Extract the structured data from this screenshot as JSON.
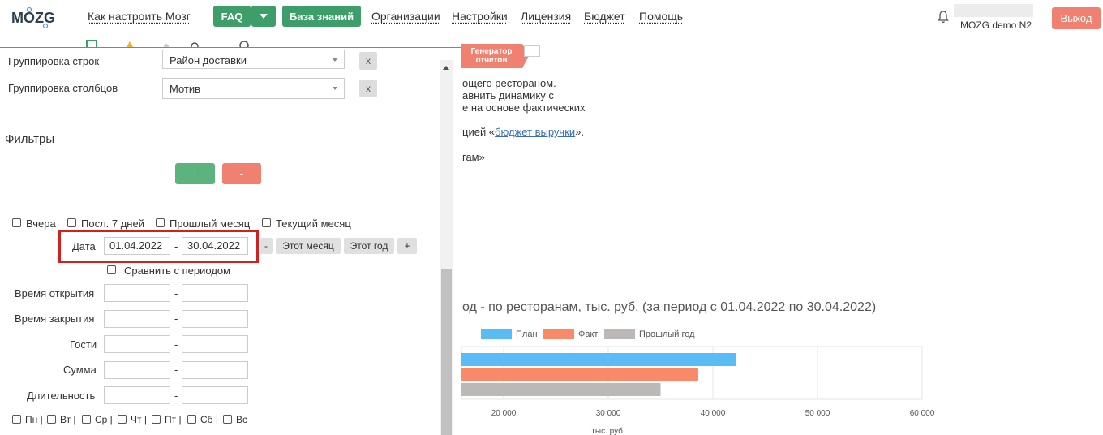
{
  "header": {
    "logo": "MOZG",
    "nav_links": [
      "Как настроить Мозг",
      "Организации",
      "Настройки",
      "Лицензия",
      "Бюджет",
      "Помощь"
    ],
    "faq_label": "FAQ",
    "kb_label": "База знаний",
    "user_name": "MOZG demo N2",
    "exit_label": "Выход"
  },
  "panel": {
    "row_grouping_label": "Группировка строк",
    "row_grouping_value": "Район доставки",
    "col_grouping_label": "Группировка столбцов",
    "col_grouping_value": "Мотив",
    "x_label": "x",
    "filters_title": "Фильтры",
    "plus_label": "+",
    "minus_label": "-",
    "quick_periods": [
      "Вчера",
      "Посл. 7 дней",
      "Прошлый месяц",
      "Текущий месяц"
    ],
    "date_label": "Дата",
    "date_from": "01.04.2022",
    "date_to": "30.04.2022",
    "date_minus": "-",
    "this_month": "Этот месяц",
    "this_year": "Этот год",
    "date_plus": "+",
    "compare_label": "Сравнить с периодом",
    "range_filters": [
      "Время открытия",
      "Время закрытия",
      "Гости",
      "Сумма",
      "Длительность"
    ],
    "range_sep": "-",
    "weekdays": [
      "Пн |",
      "Вт |",
      "Ср |",
      "Чт |",
      "Пт |",
      "Сб |",
      "Вс"
    ]
  },
  "report": {
    "tab_badge": "Генератор отчетов",
    "desc_lines": [
      "ощего рестораном.",
      "авнить динамику с",
      "е на основе фактических"
    ],
    "desc_link_prefix": "цией «",
    "desc_link": "бюджет выручки",
    "desc_link_suffix": "».",
    "desc_quote": "гам»"
  },
  "chart_data": {
    "type": "bar",
    "orientation": "horizontal",
    "title": "од - по ресторанам, тыс. руб. (за период с 01.04.2022 по 30.04.2022)",
    "xlabel": "тыс. руб.",
    "xlim": [
      10000,
      60000
    ],
    "x_ticks": [
      "20 000",
      "30 000",
      "40 000",
      "50 000",
      "60 000"
    ],
    "grid": true,
    "legend_position": "top",
    "series": [
      {
        "name": "План",
        "color": "#5bbcf5",
        "values": [
          42200
        ]
      },
      {
        "name": "Факт",
        "color": "#f88a6a",
        "values": [
          38600
        ]
      },
      {
        "name": "Прошлый год",
        "color": "#bdb8b8",
        "values": [
          35000
        ]
      }
    ]
  },
  "colors": {
    "accent_green": "#3d9e6a",
    "accent_red": "#f08070",
    "highlight": "#d02020"
  }
}
